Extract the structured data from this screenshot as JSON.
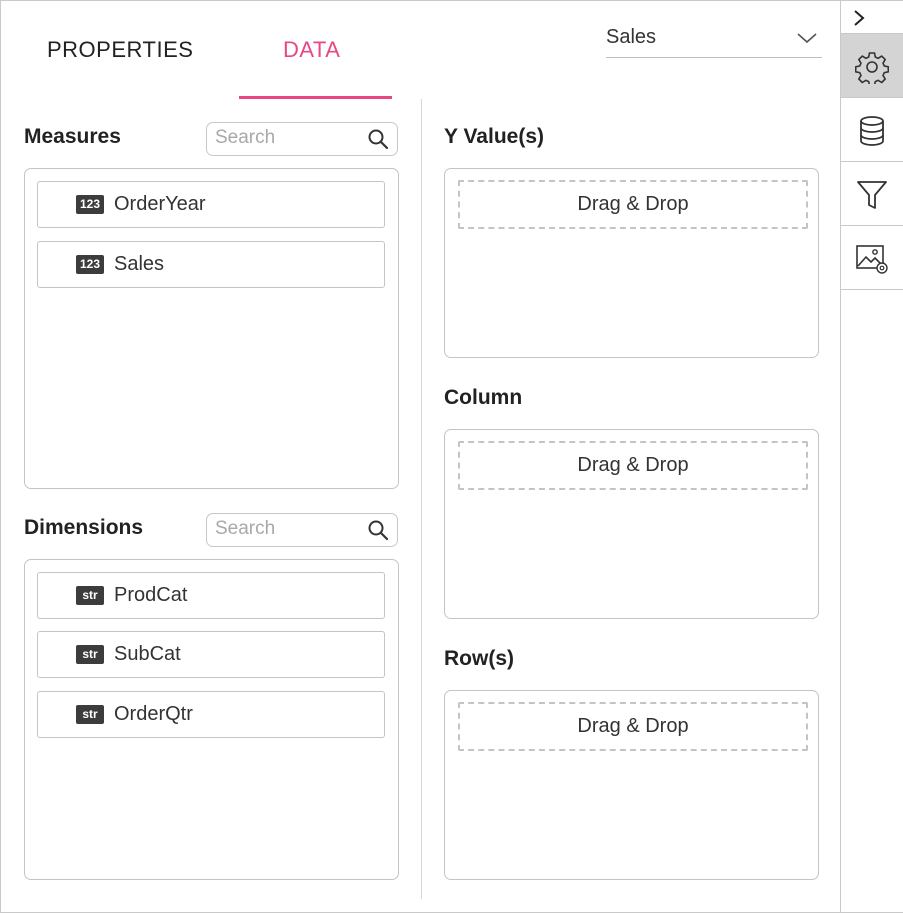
{
  "tabs": [
    {
      "label": "PROPERTIES",
      "active": false
    },
    {
      "label": "DATA",
      "active": true
    }
  ],
  "accent_color": "#e94784",
  "series_dropdown": {
    "selected": "Sales"
  },
  "measures": {
    "title": "Measures",
    "search_placeholder": "Search",
    "items": [
      {
        "type": "123",
        "label": "OrderYear"
      },
      {
        "type": "123",
        "label": "Sales"
      }
    ]
  },
  "dimensions": {
    "title": "Dimensions",
    "search_placeholder": "Search",
    "items": [
      {
        "type": "str",
        "label": "ProdCat"
      },
      {
        "type": "str",
        "label": "SubCat"
      },
      {
        "type": "str",
        "label": "OrderQtr"
      }
    ]
  },
  "drop_sections": [
    {
      "title": "Y Value(s)",
      "placeholder": "Drag & Drop"
    },
    {
      "title": "Column",
      "placeholder": "Drag & Drop"
    },
    {
      "title": "Row(s)",
      "placeholder": "Drag & Drop"
    }
  ],
  "rail": {
    "toggle_icon": "chevron-right-icon",
    "buttons": [
      {
        "icon": "gear-icon",
        "active": true
      },
      {
        "icon": "database-icon",
        "active": false
      },
      {
        "icon": "filter-icon",
        "active": false
      },
      {
        "icon": "image-settings-icon",
        "active": false
      }
    ]
  }
}
